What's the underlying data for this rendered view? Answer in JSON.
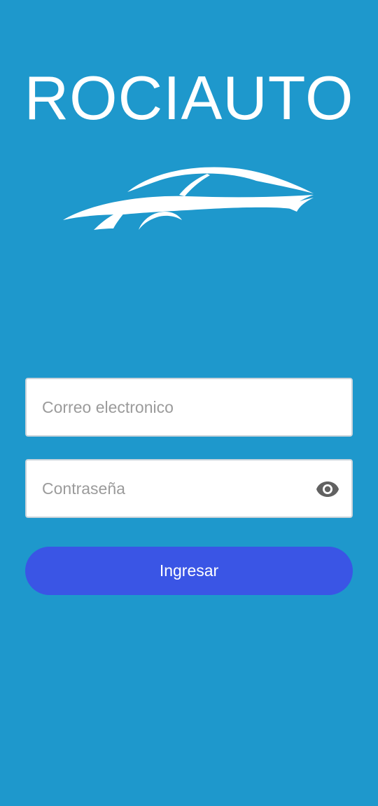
{
  "brand": {
    "title": "ROCIAUTO",
    "logo_icon": "sports-car-icon"
  },
  "login_form": {
    "email": {
      "placeholder": "Correo electronico",
      "value": ""
    },
    "password": {
      "placeholder": "Contraseña",
      "value": "",
      "toggle_icon": "eye-icon"
    },
    "submit_label": "Ingresar"
  },
  "colors": {
    "background": "#1e98cc",
    "button": "#3a55e5",
    "text_on_primary": "#ffffff",
    "placeholder": "#9b9b9b",
    "icon": "#616161"
  }
}
